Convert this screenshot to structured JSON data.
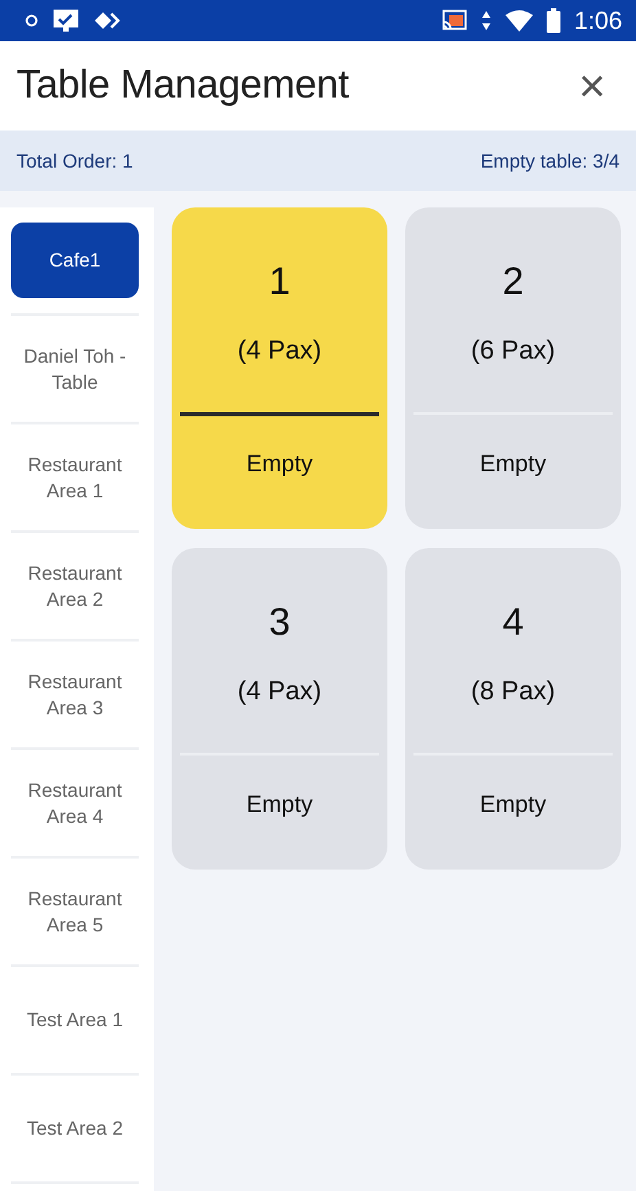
{
  "status_bar": {
    "time": "1:06"
  },
  "header": {
    "title": "Table Management",
    "close": "×"
  },
  "summary": {
    "total_order": "Total Order: 1",
    "empty_tables": "Empty table: 3/4"
  },
  "areas": [
    {
      "label": "Cafe1",
      "selected": true
    },
    {
      "label": "Daniel Toh - Table",
      "selected": false
    },
    {
      "label": "Restaurant Area 1",
      "selected": false
    },
    {
      "label": "Restaurant Area 2",
      "selected": false
    },
    {
      "label": "Restaurant Area 3",
      "selected": false
    },
    {
      "label": "Restaurant Area 4",
      "selected": false
    },
    {
      "label": "Restaurant Area 5",
      "selected": false
    },
    {
      "label": "Test Area 1",
      "selected": false
    },
    {
      "label": "Test Area 2",
      "selected": false
    }
  ],
  "tables": [
    {
      "number": "1",
      "pax": "(4 Pax)",
      "status": "Empty",
      "selected": true
    },
    {
      "number": "2",
      "pax": "(6 Pax)",
      "status": "Empty",
      "selected": false
    },
    {
      "number": "3",
      "pax": "(4 Pax)",
      "status": "Empty",
      "selected": false
    },
    {
      "number": "4",
      "pax": "(8 Pax)",
      "status": "Empty",
      "selected": false
    }
  ]
}
